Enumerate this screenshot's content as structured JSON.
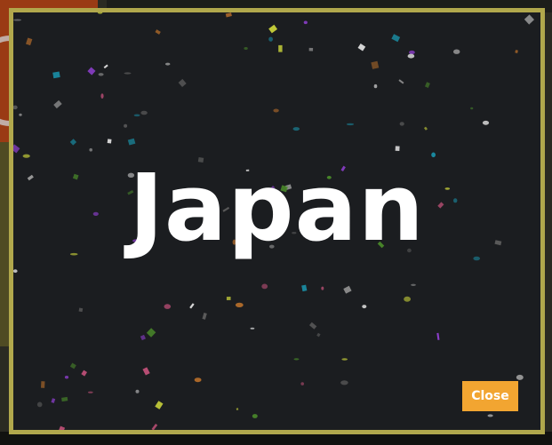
{
  "dialog": {
    "title": "Japan",
    "close_label": "Close"
  },
  "colors": {
    "border": "#b1a84c",
    "panel": "#1b1d20",
    "title": "#ffffff",
    "close_button": "#f2a531"
  },
  "confetti_palette": [
    "#d8d8d8",
    "#9b9b9b",
    "#8f3fd0",
    "#1a8aa0",
    "#c05078",
    "#c9d23a",
    "#b06a2a",
    "#4a8a2a",
    "#5a5a5a"
  ]
}
